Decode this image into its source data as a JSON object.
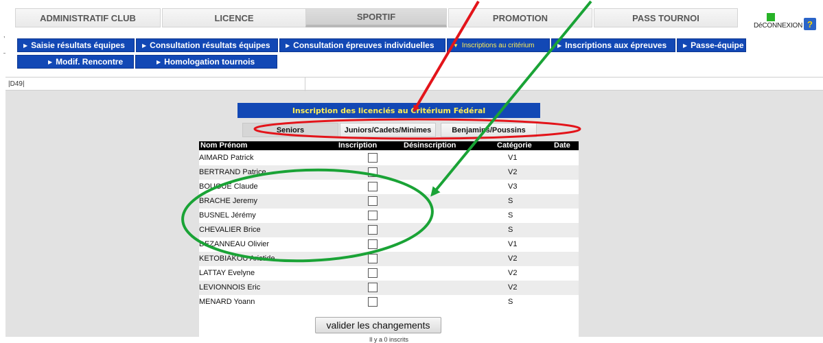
{
  "top_tabs": [
    {
      "label": "ADMINISTRATIF CLUB"
    },
    {
      "label": "LICENCE"
    },
    {
      "label": "SPORTIF"
    },
    {
      "label": "PROMOTION"
    },
    {
      "label": "PASS TOURNOI"
    }
  ],
  "header": {
    "logout_label": "DéCONNEXION",
    "help_label": "?",
    "id_label": "|D49|"
  },
  "submenu": [
    {
      "label": "Saisie résultats équipes"
    },
    {
      "label": "Consultation résultats équipes"
    },
    {
      "label": "Consultation épreuves individuelles"
    },
    {
      "label": "Inscriptions au critérium"
    },
    {
      "label": "Inscriptions aux épreuves"
    },
    {
      "label": "Passe-équipe"
    },
    {
      "label": "Modif. Rencontre"
    },
    {
      "label": "Homologation tournois"
    }
  ],
  "panel": {
    "title": "Inscription des licenciés au Critérium Fédéral",
    "category_tabs": [
      {
        "label": "Seniors"
      },
      {
        "label": "Juniors/Cadets/Minimes"
      },
      {
        "label": "Benjamins/Poussins"
      }
    ],
    "columns": {
      "name": "Nom Prénom",
      "inscription": "Inscription",
      "desinscription": "Désinscription",
      "categorie": "Catégorie",
      "date": "Date"
    },
    "rows": [
      {
        "name": "AIMARD Patrick",
        "category": "V1"
      },
      {
        "name": "BERTRAND Patrice",
        "category": "V2"
      },
      {
        "name": "BOUGUE Claude",
        "category": "V3"
      },
      {
        "name": "BRACHE Jeremy",
        "category": "S"
      },
      {
        "name": "BUSNEL Jérémy",
        "category": "S"
      },
      {
        "name": "CHEVALIER Brice",
        "category": "S"
      },
      {
        "name": "DEZANNEAU Olivier",
        "category": "V1"
      },
      {
        "name": "KETOBIAKOU Aristide",
        "category": "V2"
      },
      {
        "name": "LATTAY Evelyne",
        "category": "V2"
      },
      {
        "name": "LEVIONNOIS Eric",
        "category": "V2"
      },
      {
        "name": "MENARD Yoann",
        "category": "S"
      }
    ],
    "submit_label": "valider les changements",
    "count_text": "Il y a 0 inscrits"
  },
  "colors": {
    "menu_blue": "#1248b5",
    "title_yellow": "#ffee55",
    "annotation_red": "#e3141a",
    "annotation_green": "#1aa336"
  }
}
